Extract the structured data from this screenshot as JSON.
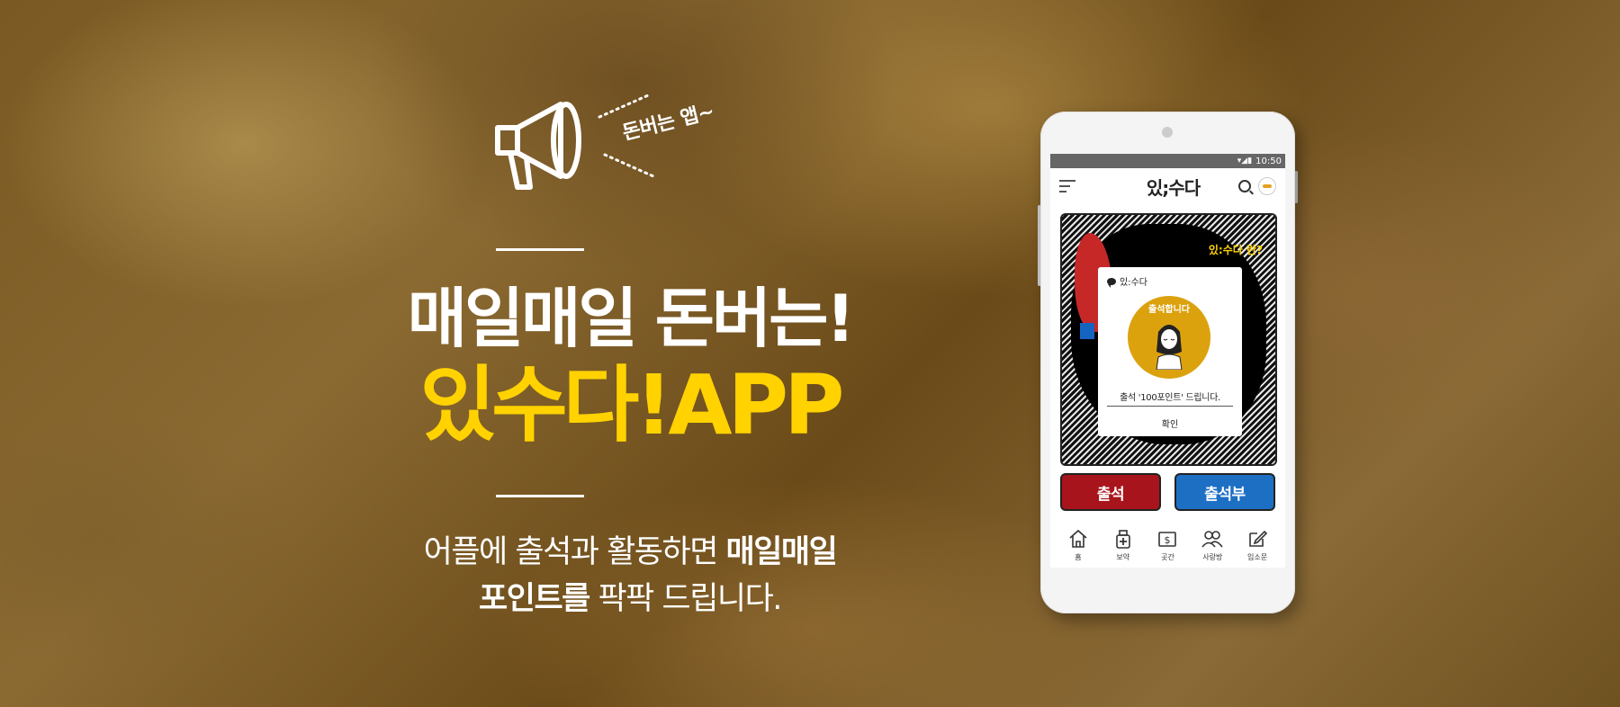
{
  "promo": {
    "tagline_burst": "돈버는 앱~",
    "headline_line1": "매일매일 돈버는!",
    "headline_line2": "있수다!APP",
    "desc_line1_plain": "어플에 출석과 활동하면 ",
    "desc_line1_bold": "매일매일",
    "desc_line2_bold": "포인트를",
    "desc_line2_plain": " 팍팍 드립니다."
  },
  "phone": {
    "status_time": "10:50",
    "status_icons": "▾◢▮",
    "app_title": "있;수다",
    "comic_question": "있:수다 란?",
    "dialog": {
      "header": "있:수다",
      "badge_text": "출석합니다",
      "message": "출석 '100포인트' 드립니다.",
      "confirm": "확인"
    },
    "buttons": {
      "attend": "출석",
      "attend_book": "출석부"
    },
    "tabs": [
      {
        "label": "홈",
        "icon": "home-icon"
      },
      {
        "label": "보약",
        "icon": "medicine-icon"
      },
      {
        "label": "곳간",
        "icon": "money-icon"
      },
      {
        "label": "사랑방",
        "icon": "people-icon"
      },
      {
        "label": "입소문",
        "icon": "write-icon"
      }
    ]
  },
  "colors": {
    "accent_yellow": "#ffd200",
    "attend_red": "#a8141c",
    "book_blue": "#1d6fc4"
  }
}
